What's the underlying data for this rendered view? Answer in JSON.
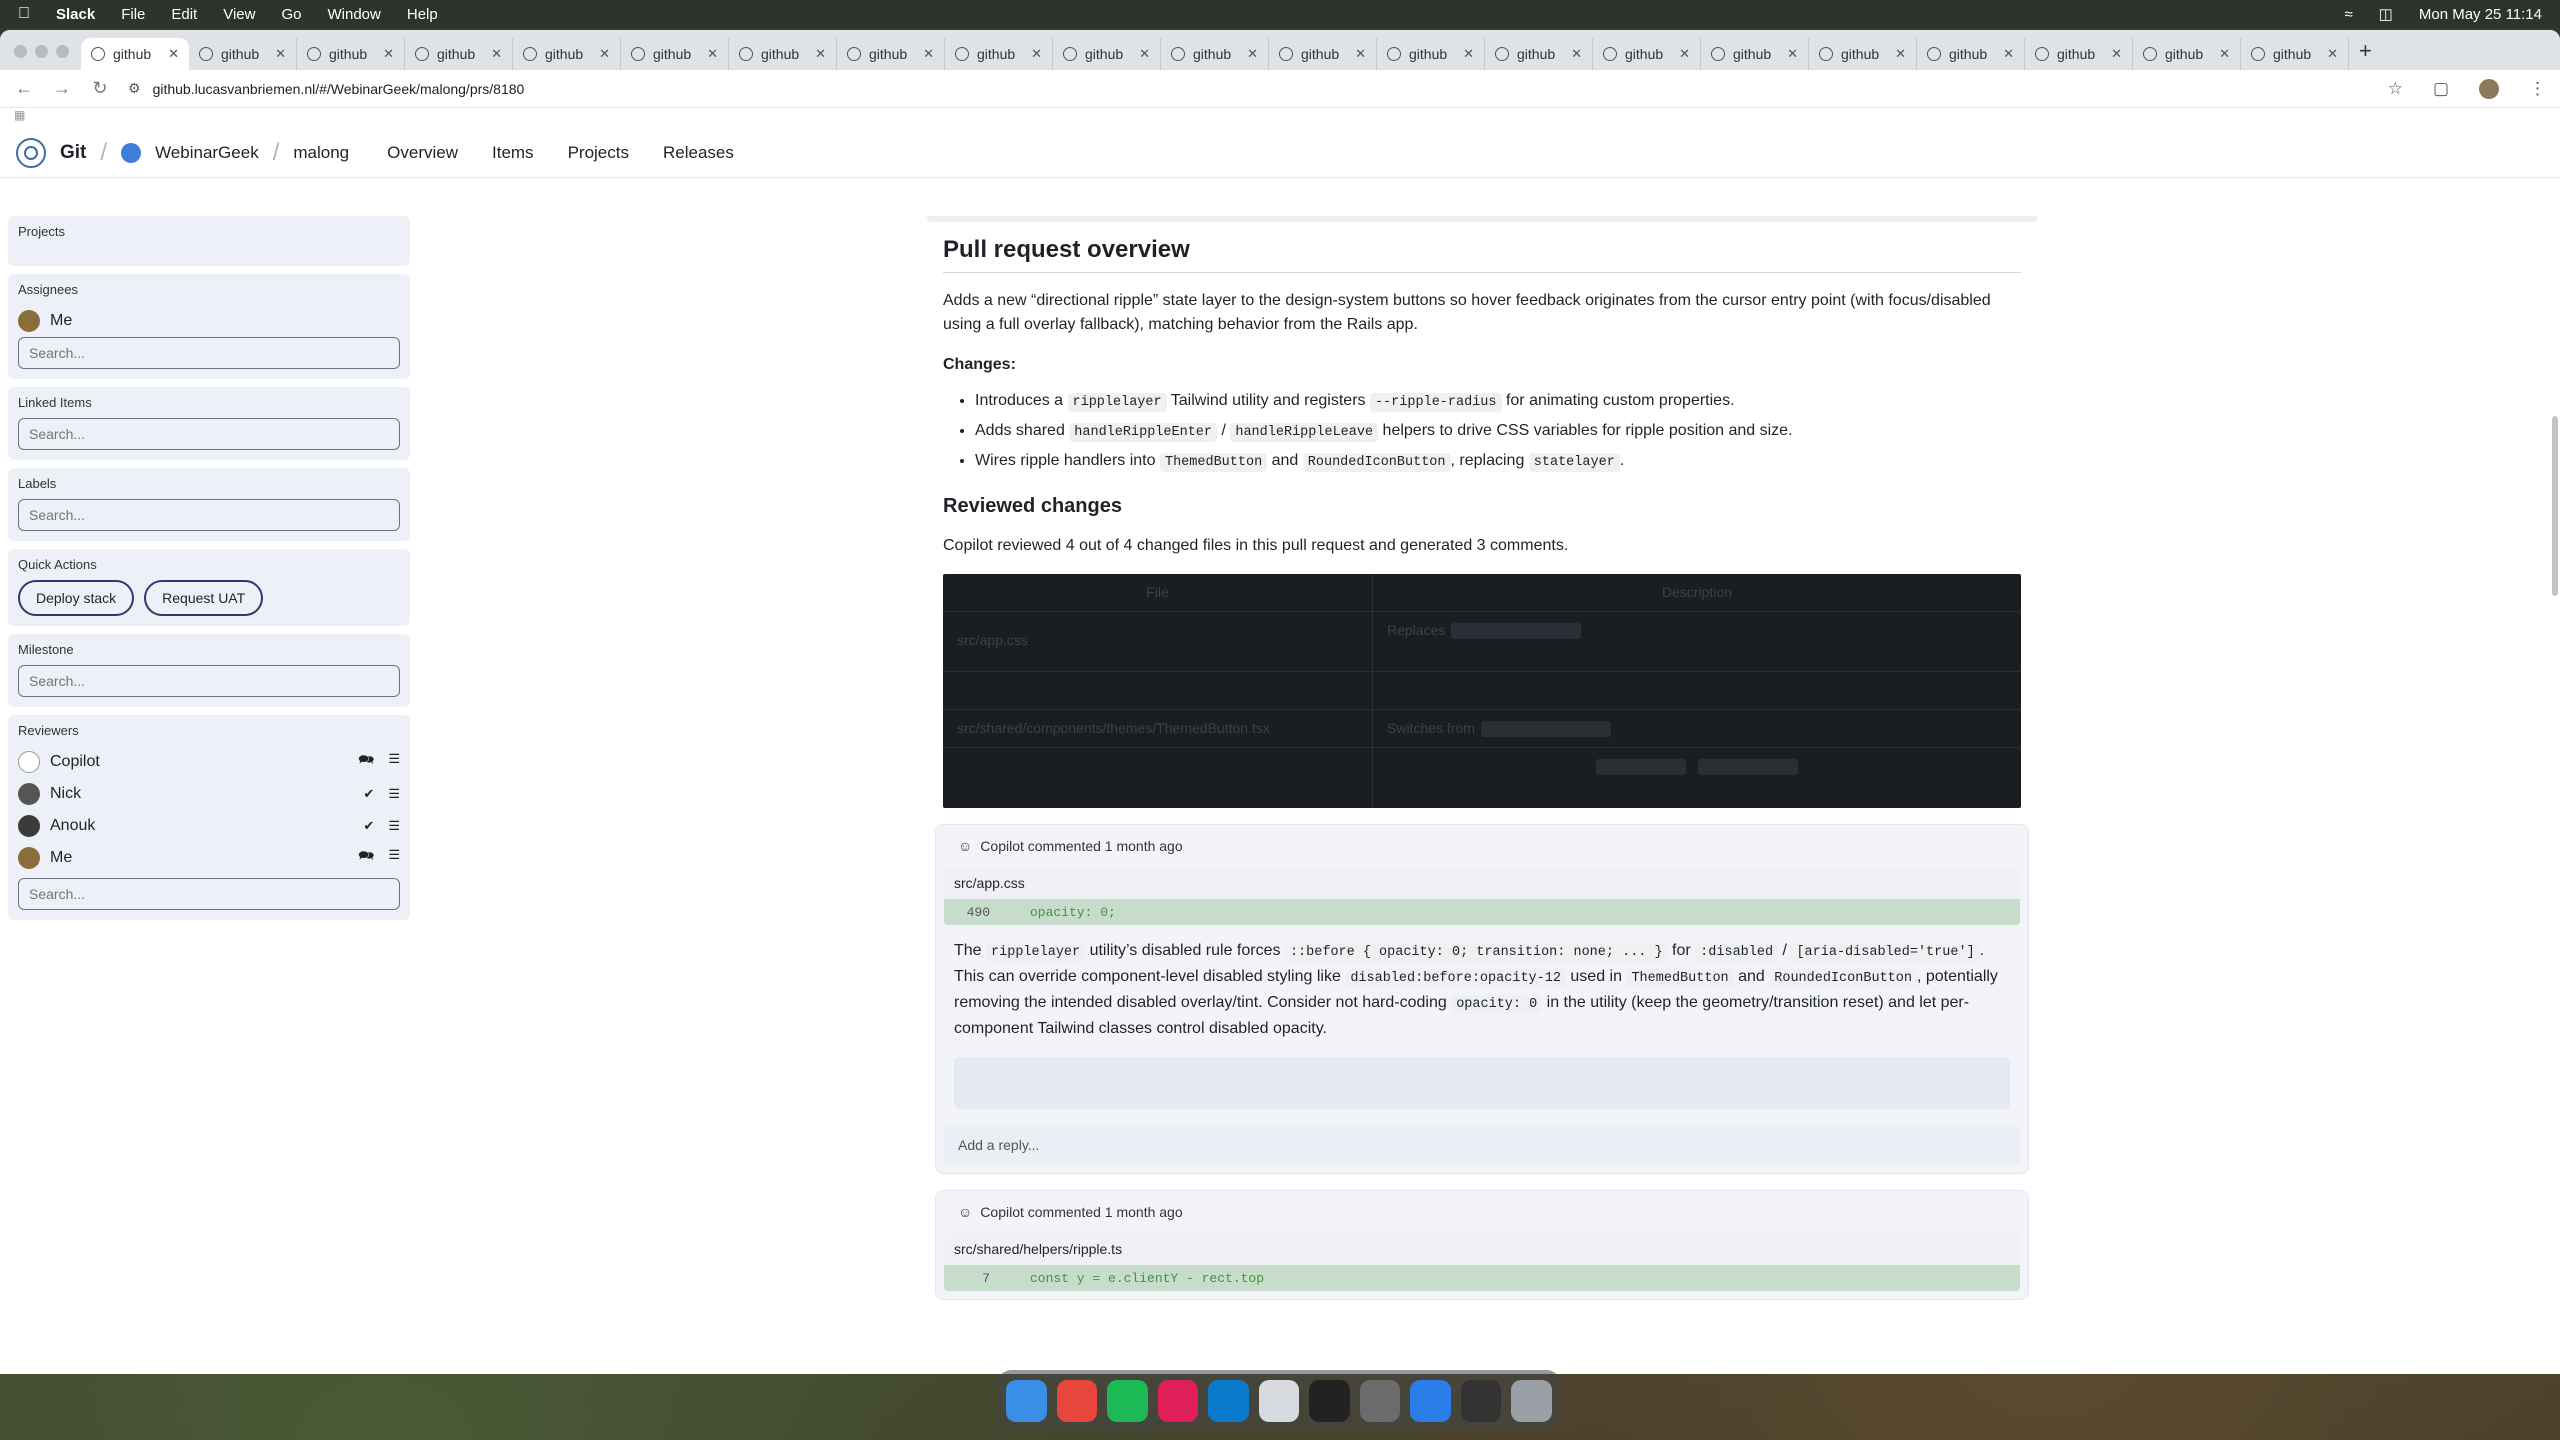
{
  "menubar": {
    "app": "Slack",
    "items": [
      "File",
      "Edit",
      "View",
      "Go",
      "Window",
      "Help"
    ],
    "clock": "Mon May 25  11:14"
  },
  "browser": {
    "tabs": [
      {
        "label": "github",
        "active": true
      },
      {
        "label": "github"
      },
      {
        "label": "github"
      },
      {
        "label": "github"
      },
      {
        "label": "github"
      },
      {
        "label": "github"
      },
      {
        "label": "github"
      },
      {
        "label": "github"
      },
      {
        "label": "github"
      },
      {
        "label": "github"
      },
      {
        "label": "github"
      },
      {
        "label": "github"
      },
      {
        "label": "github"
      },
      {
        "label": "github"
      },
      {
        "label": "github"
      },
      {
        "label": "github"
      },
      {
        "label": "github"
      },
      {
        "label": "github"
      },
      {
        "label": "github"
      },
      {
        "label": "github"
      },
      {
        "label": "github"
      }
    ],
    "url": "github.lucasvanbriemen.nl/#/WebinarGeek/malong/prs/8180"
  },
  "header": {
    "brand": "Git",
    "org": "WebinarGeek",
    "repo": "malong",
    "nav": [
      "Overview",
      "Items",
      "Projects",
      "Releases"
    ]
  },
  "sidebar": {
    "projects_label": "Projects",
    "assignees_label": "Assignees",
    "assignee": "Me",
    "linked_label": "Linked Items",
    "labels_label": "Labels",
    "quick_label": "Quick Actions",
    "deploy_btn": "Deploy stack",
    "uat_btn": "Request UAT",
    "milestone_label": "Milestone",
    "reviewers_label": "Reviewers",
    "reviewers": [
      {
        "name": "Copilot",
        "status": "commented"
      },
      {
        "name": "Nick",
        "status": "approved"
      },
      {
        "name": "Anouk",
        "status": "approved"
      },
      {
        "name": "Me",
        "status": "commented"
      }
    ],
    "search_placeholder": "Search..."
  },
  "main": {
    "title": "Pull request overview",
    "intro": "Adds a new “directional ripple” state layer to the design-system buttons so hover feedback originates from the cursor entry point (with focus/disabled using a full overlay fallback), matching behavior from the Rails app.",
    "changes_label": "Changes:",
    "b1_pre": "Introduces a ",
    "b1_code1": "ripplelayer",
    "b1_mid": " Tailwind utility and registers ",
    "b1_code2": "--ripple-radius",
    "b1_post": " for animating custom properties.",
    "b2_pre": "Adds shared ",
    "b2_code1": "handleRippleEnter",
    "b2_mid": " / ",
    "b2_code2": "handleRippleLeave",
    "b2_post": " helpers to drive CSS variables for ripple position and size.",
    "b3_pre": "Wires ripple handlers into ",
    "b3_code1": "ThemedButton",
    "b3_mid": " and ",
    "b3_code2": "RoundedIconButton",
    "b3_mid2": ", replacing ",
    "b3_code3": "statelayer",
    "b3_post": ".",
    "reviewed_title": "Reviewed changes",
    "reviewed_text": "Copilot reviewed 4 out of 4 changed files in this pull request and generated 3 comments.",
    "table": {
      "headers": [
        "File",
        "Description"
      ],
      "rows": [
        [
          "src/app.css",
          "Replaces"
        ],
        [
          "",
          ""
        ],
        [
          "src/shared/components/themes/ThemedButton.tsx",
          "Switches from"
        ],
        [
          "",
          ""
        ]
      ]
    }
  },
  "comments": [
    {
      "author": "Copilot commented 1 month ago",
      "file": "src/app.css",
      "line_no": "490",
      "line_code": "opacity: 0;",
      "t1": "The ",
      "c1": "ripplelayer",
      "t2": " utility’s disabled rule forces ",
      "c2": "::before { opacity: 0; transition: none; ... }",
      "t3": " for ",
      "c3": ":disabled",
      "t4": " / ",
      "c4": "[aria-disabled='true']",
      "t5": ". This can override component-level disabled styling like ",
      "c5": "disabled:before:opacity-12",
      "t6": " used in ",
      "c6": "ThemedButton",
      "t7": " and ",
      "c7": "RoundedIconButton",
      "t8": ", potentially removing the intended disabled overlay/tint. Consider not hard-coding ",
      "c8": "opacity: 0",
      "t9": " in the utility (keep the geometry/transition reset) and let per-component Tailwind classes control disabled opacity.",
      "reply_placeholder": "Add a reply..."
    },
    {
      "author": "Copilot commented 1 month ago",
      "file": "src/shared/helpers/ripple.ts",
      "line_no": "7",
      "line_code": "const y = e.clientY - rect.top"
    }
  ]
}
